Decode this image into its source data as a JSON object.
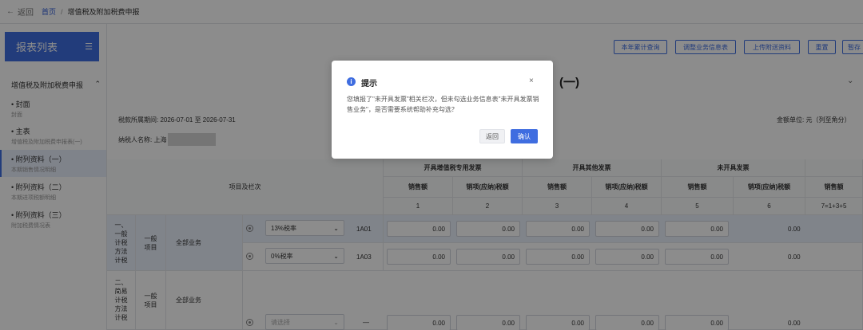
{
  "topbar": {
    "back": "返回",
    "home": "首页",
    "sep": "/",
    "current": "增值税及附加税费申报"
  },
  "sidebar": {
    "title": "报表列表",
    "group": "增值税及附加税费申报",
    "items": [
      {
        "title": "• 封面",
        "sub": "封面"
      },
      {
        "title": "• 主表",
        "sub": "增值税及附加税费申报表(一)"
      },
      {
        "title": "• 附列资料（一）",
        "sub": "本期销售情况明细"
      },
      {
        "title": "• 附列资料（二）",
        "sub": "本期进项税额明细"
      },
      {
        "title": "• 附列资料（三）",
        "sub": "附加税费情况表"
      }
    ]
  },
  "toolbar": {
    "btn1": "本年累计查询",
    "btn2": "调整业务信息表",
    "btn3": "上传附送资料",
    "btn4": "重置",
    "btn5": "暂存"
  },
  "page": {
    "title": "(一)",
    "chev": "⌄",
    "period": "税款所属期间: 2026-07-01 至 2026-07-31",
    "unit": "金额单位: 元（列至角分）",
    "taxpayer": "纳税人名称: 上海"
  },
  "table": {
    "header_item": "项目及栏次",
    "groups": [
      "开具增值税专用发票",
      "开具其他发票",
      "未开具发票"
    ],
    "sub": [
      "销售额",
      "销项(应纳)税额",
      "销售额",
      "销项(应纳)税额",
      "销售额",
      "销项(应纳)税额",
      "销售额"
    ],
    "nums": [
      "1",
      "2",
      "3",
      "4",
      "5",
      "6",
      "7=1+3+5"
    ],
    "sec1": "一、一般计税方法计税",
    "sec2": "二、简易计税方法计税",
    "general_item": "一般项目",
    "all_business": "全部业务",
    "row1": {
      "rate": "13%税率",
      "code": "1A01",
      "vals": [
        "0.00",
        "0.00",
        "0.00",
        "0.00",
        "0.00",
        "0.00"
      ]
    },
    "row2": {
      "rate": "0%税率",
      "code": "1A03",
      "vals": [
        "0.00",
        "0.00",
        "0.00",
        "0.00",
        "0.00",
        "0.00"
      ]
    },
    "row3": {
      "rate_placeholder": "请选择",
      "code": "—",
      "vals": [
        "0.00",
        "0.00",
        "0.00",
        "0.00",
        "0.00",
        "0.00"
      ]
    }
  },
  "modal": {
    "title": "提示",
    "close": "×",
    "body": "您填报了\"未开具发票\"相关栏次，但未勾选业务信息表\"未开具发票销售业务\"，是否需要系统帮助补充勾选？",
    "cancel": "返回",
    "confirm": "确认"
  }
}
